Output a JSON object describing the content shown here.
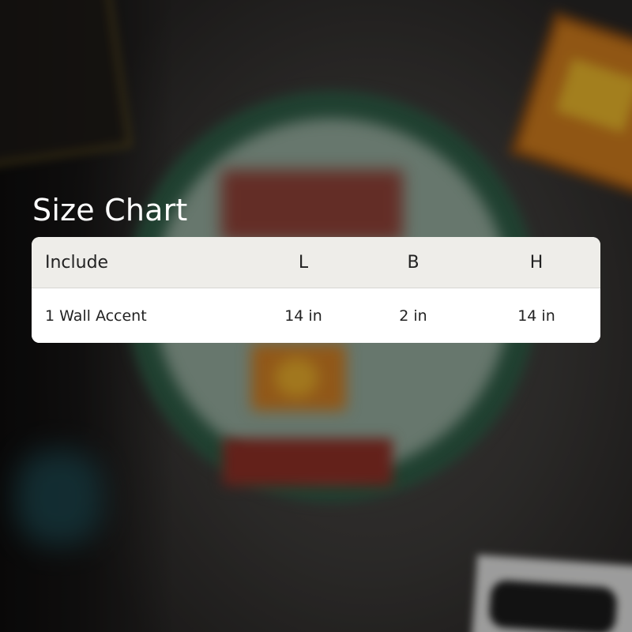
{
  "size_chart": {
    "title": "Size Chart",
    "columns": [
      "Include",
      "L",
      "B",
      "H"
    ],
    "rows": [
      [
        "1 Wall Accent",
        "14 in",
        "2 in",
        "14 in"
      ]
    ]
  }
}
